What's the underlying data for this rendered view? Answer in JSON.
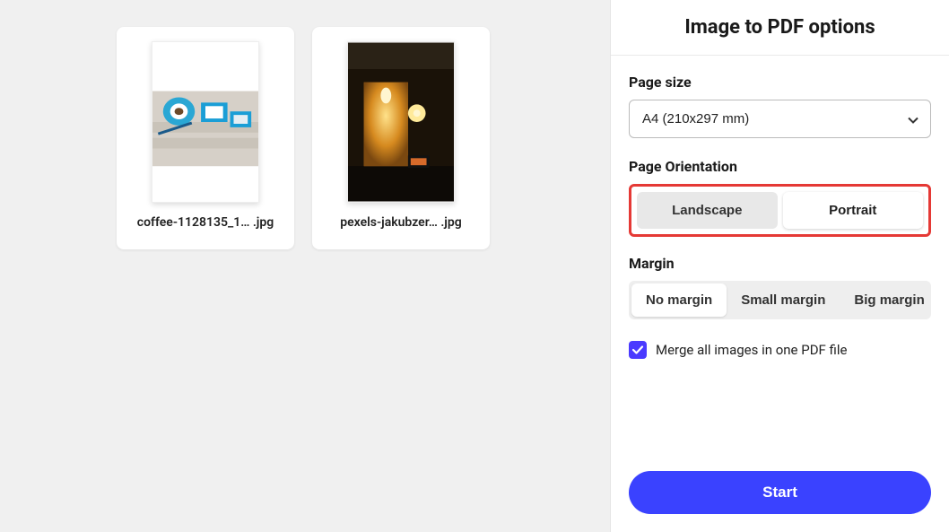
{
  "files": [
    {
      "name": "coffee-1128135_1… .jpg"
    },
    {
      "name": "pexels-jakubzer… .jpg"
    }
  ],
  "sidebar": {
    "title": "Image to PDF options",
    "pageSizeLabel": "Page size",
    "pageSizeValue": "A4 (210x297 mm)",
    "orientationLabel": "Page Orientation",
    "orientation": {
      "landscape": "Landscape",
      "portrait": "Portrait"
    },
    "marginLabel": "Margin",
    "margins": {
      "none": "No margin",
      "small": "Small margin",
      "big": "Big margin"
    },
    "mergeLabel": "Merge all images in one PDF file",
    "startLabel": "Start"
  }
}
